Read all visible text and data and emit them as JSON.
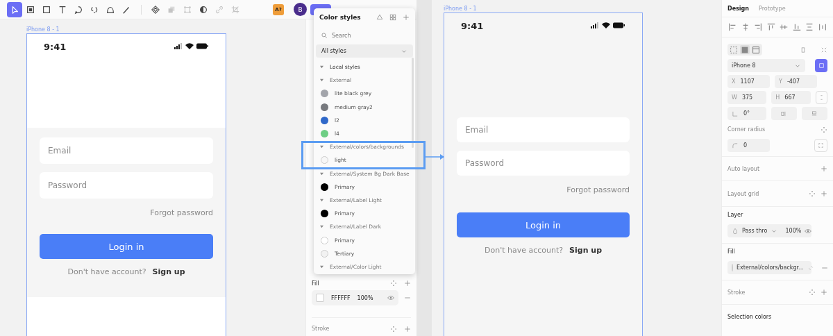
{
  "left_screen": {
    "toolbar": {
      "tools": [
        {
          "kind": "cursor",
          "selected": true
        },
        {
          "kind": "frame",
          "selected": false
        },
        {
          "kind": "rect",
          "selected": false
        },
        {
          "kind": "text",
          "selected": false
        },
        {
          "kind": "bubble",
          "selected": false
        },
        {
          "kind": "lasso",
          "selected": false
        },
        {
          "kind": "blob",
          "selected": false
        },
        {
          "kind": "brush",
          "selected": false
        }
      ],
      "actions": [
        {
          "kind": "diamond",
          "disabled": false
        },
        {
          "kind": "boolean",
          "disabled": true
        },
        {
          "kind": "corners",
          "disabled": true
        },
        {
          "kind": "contrast",
          "disabled": false
        },
        {
          "kind": "link",
          "disabled": true
        },
        {
          "kind": "crop",
          "disabled": true
        }
      ],
      "badge": "A?",
      "avatar": "B"
    },
    "frame": {
      "label": "iPhone 8 - 1",
      "time": "9:41",
      "email_placeholder": "Email",
      "password_placeholder": "Password",
      "forgot": "Forgot password",
      "login": "Login in",
      "prompt": "Don't have account?",
      "signup": "Sign up"
    },
    "panel": {
      "fill_label": "Fill",
      "fill_hex": "FFFFFF",
      "fill_opacity": "100%",
      "stroke_label": "Stroke"
    },
    "color_styles": {
      "title": "Color styles",
      "search_placeholder": "Search",
      "filter": "All styles",
      "items": [
        {
          "kind": "heading",
          "label": "Local styles"
        },
        {
          "kind": "group",
          "label": "External"
        },
        {
          "kind": "swatch",
          "label": "lite black grey",
          "color": "#a2a4aa"
        },
        {
          "kind": "swatch",
          "label": "medium gray2",
          "color": "#77797e"
        },
        {
          "kind": "swatch",
          "label": "l2",
          "color": "#2f68c9"
        },
        {
          "kind": "swatch",
          "label": "l4",
          "color": "#6dce84"
        },
        {
          "kind": "group",
          "label": "External/colors/backgrounds"
        },
        {
          "kind": "swatch",
          "label": "light",
          "color": "#f7f7f7"
        },
        {
          "kind": "group",
          "label": "External/System Bg Dark Base"
        },
        {
          "kind": "swatch",
          "label": "Primary",
          "color": "#000000"
        },
        {
          "kind": "group",
          "label": "External/Label Light"
        },
        {
          "kind": "swatch",
          "label": "Primary",
          "color": "#000000"
        },
        {
          "kind": "group",
          "label": "External/Label Dark"
        },
        {
          "kind": "swatch",
          "label": "Primary",
          "color": "#ffffff"
        },
        {
          "kind": "swatch",
          "label": "Tertiary",
          "color": "#f2f2f2"
        },
        {
          "kind": "group",
          "label": "External/Color Light"
        }
      ]
    }
  },
  "right_screen": {
    "frame": {
      "label": "iPhone 8 - 1",
      "time": "9:41",
      "email_placeholder": "Email",
      "password_placeholder": "Password",
      "forgot": "Forgot password",
      "login": "Login in",
      "prompt": "Don't have account?",
      "signup": "Sign up"
    },
    "design_panel": {
      "tabs": [
        {
          "label": "Design",
          "selected": true
        },
        {
          "label": "Prototype",
          "selected": false
        }
      ],
      "preset": "iPhone 8",
      "x": {
        "label": "X",
        "value": "1107"
      },
      "y": {
        "label": "Y",
        "value": "-407"
      },
      "w": {
        "label": "W",
        "value": "375"
      },
      "h": {
        "label": "H",
        "value": "667"
      },
      "rotation": "0°",
      "corner_radius_label": "Corner radius",
      "corner_radius": "0",
      "auto_layout_label": "Auto layout",
      "layout_grid_label": "Layout grid",
      "layer_label": "Layer",
      "blend_mode": "Pass thro",
      "layer_opacity": "100%",
      "fill_label": "Fill",
      "fill_style": "External/colors/backgr...",
      "stroke_label": "Stroke",
      "selection_colors_label": "Selection colors"
    }
  }
}
